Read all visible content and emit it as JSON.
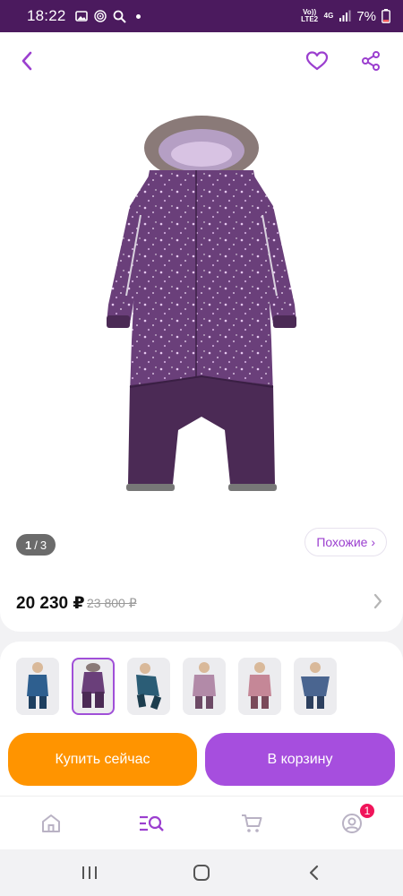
{
  "status_bar": {
    "time": "18:22",
    "network_top": "Vo)) LTE2",
    "network_4g": "4G",
    "battery": "7%"
  },
  "header": {
    "back_icon": "chevron-left-icon",
    "favorite_icon": "heart-icon",
    "share_icon": "share-icon"
  },
  "product": {
    "pager": {
      "current": "1",
      "separator": "/",
      "total": "3"
    },
    "similar_label": "Похожие ›",
    "price": "20 230 ₽",
    "old_price": "23 800 ₽"
  },
  "thumbnails": [
    {
      "selected": false,
      "color": "#2e5f8f"
    },
    {
      "selected": true,
      "color": "#4a2a55"
    },
    {
      "selected": false,
      "color": "#2b5d76"
    },
    {
      "selected": false,
      "color": "#b28aa8"
    },
    {
      "selected": false,
      "color": "#c58797"
    },
    {
      "selected": false,
      "color": "#4a6590"
    }
  ],
  "actions": {
    "buy_now": "Купить сейчас",
    "add_to_cart": "В корзину"
  },
  "tabbar": {
    "cart_badge": "1"
  },
  "colors": {
    "accent": "#a64ede",
    "buy": "#ff9400",
    "status_bar": "#4b1a5e",
    "badge": "#f0145a"
  }
}
